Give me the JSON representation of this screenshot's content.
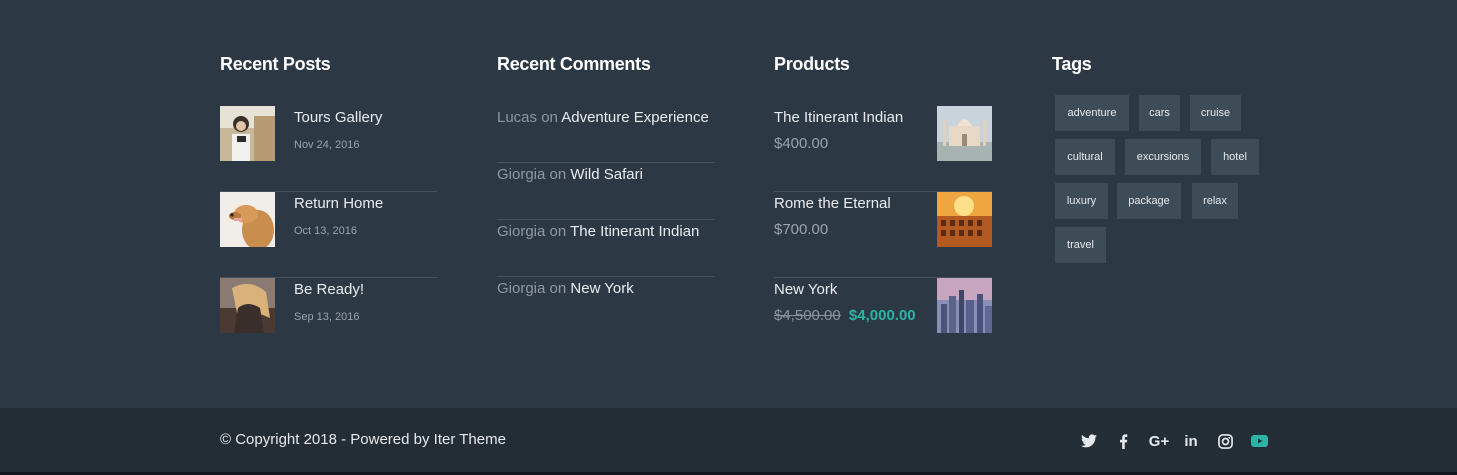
{
  "widgets": {
    "recent_posts": {
      "title": "Recent Posts",
      "items": [
        {
          "title": "Tours Gallery",
          "date": "Nov 24, 2016"
        },
        {
          "title": "Return Home",
          "date": "Oct 13, 2016"
        },
        {
          "title": "Be Ready!",
          "date": "Sep 13, 2016"
        }
      ]
    },
    "recent_comments": {
      "title": "Recent Comments",
      "items": [
        {
          "author": "Lucas",
          "on": "on",
          "post": "Adventure Experience"
        },
        {
          "author": "Giorgia",
          "on": "on",
          "post": "Wild Safari"
        },
        {
          "author": "Giorgia",
          "on": "on",
          "post": "The Itinerant Indian"
        },
        {
          "author": "Giorgia",
          "on": "on",
          "post": "New York"
        }
      ]
    },
    "products": {
      "title": "Products",
      "items": [
        {
          "title": "The Itinerant Indian",
          "price": "$400.00"
        },
        {
          "title": "Rome the Eternal",
          "price": "$700.00"
        },
        {
          "title": "New York",
          "old_price": "$4,500.00",
          "sale_price": "$4,000.00"
        }
      ]
    },
    "tags": {
      "title": "Tags",
      "items": [
        "adventure",
        "cars",
        "cruise",
        "cultural",
        "excursions",
        "hotel",
        "luxury",
        "package",
        "relax",
        "travel"
      ]
    }
  },
  "footer": {
    "copyright": "© Copyright 2018 - Powered by Iter Theme",
    "social": [
      {
        "icon": "twitter-icon"
      },
      {
        "icon": "facebook-icon"
      },
      {
        "icon": "google-plus-icon",
        "text": "G+"
      },
      {
        "icon": "linkedin-icon",
        "text": "in"
      },
      {
        "icon": "instagram-icon"
      },
      {
        "icon": "youtube-icon"
      }
    ]
  },
  "colors": {
    "background": "#2c3945",
    "footer_bar": "#222d36",
    "accent": "#2bb3a3",
    "tag_bg": "#3e4c58"
  }
}
